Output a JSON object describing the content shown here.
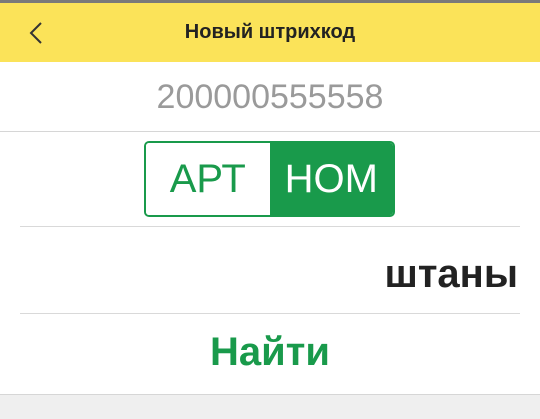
{
  "header": {
    "title": "Новый штрихкод",
    "back_icon": "chevron-left-icon",
    "background_color": "#fbe359"
  },
  "barcode": {
    "value": "200000555558"
  },
  "mode_toggle": {
    "options": [
      "АРТ",
      "НОМ"
    ],
    "selected": "НОМ",
    "accent_color": "#199a4b"
  },
  "result": {
    "value": "штаны"
  },
  "actions": {
    "find_label": "Найти"
  }
}
